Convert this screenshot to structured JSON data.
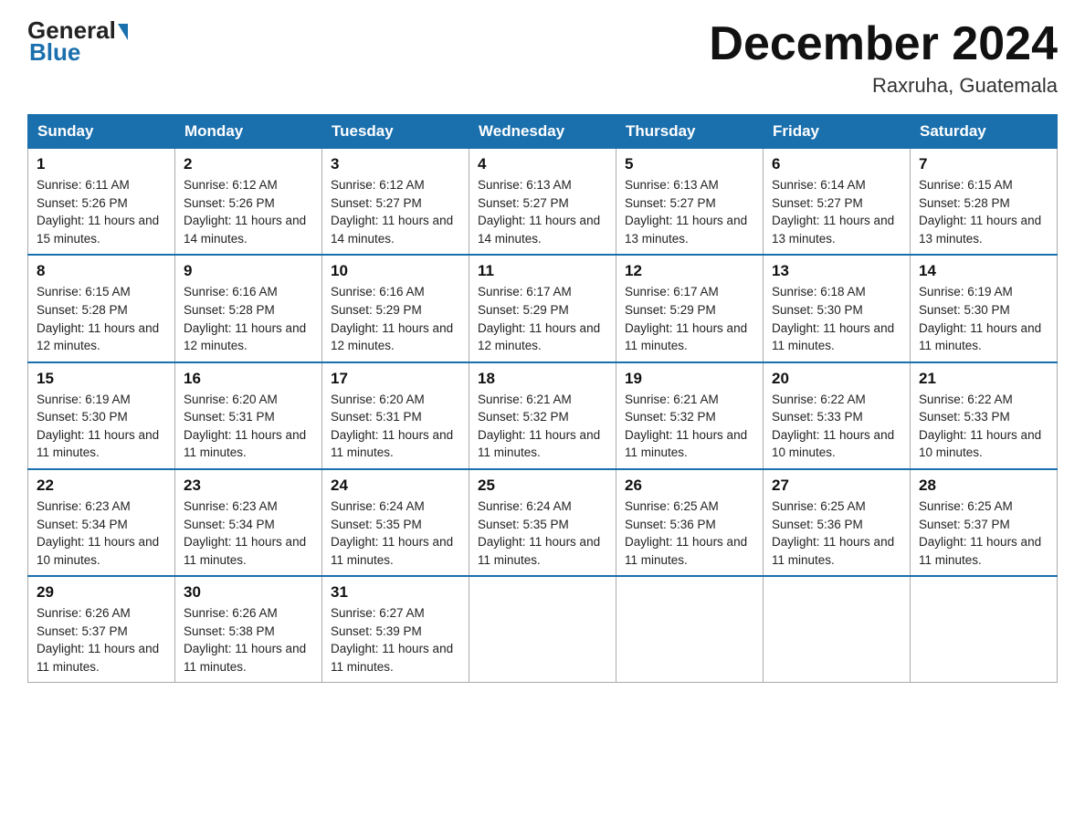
{
  "header": {
    "logo_general": "General",
    "logo_blue": "Blue",
    "month_title": "December 2024",
    "location": "Raxruha, Guatemala"
  },
  "days_of_week": [
    "Sunday",
    "Monday",
    "Tuesday",
    "Wednesday",
    "Thursday",
    "Friday",
    "Saturday"
  ],
  "weeks": [
    [
      {
        "num": "1",
        "sunrise": "6:11 AM",
        "sunset": "5:26 PM",
        "daylight": "11 hours and 15 minutes."
      },
      {
        "num": "2",
        "sunrise": "6:12 AM",
        "sunset": "5:26 PM",
        "daylight": "11 hours and 14 minutes."
      },
      {
        "num": "3",
        "sunrise": "6:12 AM",
        "sunset": "5:27 PM",
        "daylight": "11 hours and 14 minutes."
      },
      {
        "num": "4",
        "sunrise": "6:13 AM",
        "sunset": "5:27 PM",
        "daylight": "11 hours and 14 minutes."
      },
      {
        "num": "5",
        "sunrise": "6:13 AM",
        "sunset": "5:27 PM",
        "daylight": "11 hours and 13 minutes."
      },
      {
        "num": "6",
        "sunrise": "6:14 AM",
        "sunset": "5:27 PM",
        "daylight": "11 hours and 13 minutes."
      },
      {
        "num": "7",
        "sunrise": "6:15 AM",
        "sunset": "5:28 PM",
        "daylight": "11 hours and 13 minutes."
      }
    ],
    [
      {
        "num": "8",
        "sunrise": "6:15 AM",
        "sunset": "5:28 PM",
        "daylight": "11 hours and 12 minutes."
      },
      {
        "num": "9",
        "sunrise": "6:16 AM",
        "sunset": "5:28 PM",
        "daylight": "11 hours and 12 minutes."
      },
      {
        "num": "10",
        "sunrise": "6:16 AM",
        "sunset": "5:29 PM",
        "daylight": "11 hours and 12 minutes."
      },
      {
        "num": "11",
        "sunrise": "6:17 AM",
        "sunset": "5:29 PM",
        "daylight": "11 hours and 12 minutes."
      },
      {
        "num": "12",
        "sunrise": "6:17 AM",
        "sunset": "5:29 PM",
        "daylight": "11 hours and 11 minutes."
      },
      {
        "num": "13",
        "sunrise": "6:18 AM",
        "sunset": "5:30 PM",
        "daylight": "11 hours and 11 minutes."
      },
      {
        "num": "14",
        "sunrise": "6:19 AM",
        "sunset": "5:30 PM",
        "daylight": "11 hours and 11 minutes."
      }
    ],
    [
      {
        "num": "15",
        "sunrise": "6:19 AM",
        "sunset": "5:30 PM",
        "daylight": "11 hours and 11 minutes."
      },
      {
        "num": "16",
        "sunrise": "6:20 AM",
        "sunset": "5:31 PM",
        "daylight": "11 hours and 11 minutes."
      },
      {
        "num": "17",
        "sunrise": "6:20 AM",
        "sunset": "5:31 PM",
        "daylight": "11 hours and 11 minutes."
      },
      {
        "num": "18",
        "sunrise": "6:21 AM",
        "sunset": "5:32 PM",
        "daylight": "11 hours and 11 minutes."
      },
      {
        "num": "19",
        "sunrise": "6:21 AM",
        "sunset": "5:32 PM",
        "daylight": "11 hours and 11 minutes."
      },
      {
        "num": "20",
        "sunrise": "6:22 AM",
        "sunset": "5:33 PM",
        "daylight": "11 hours and 10 minutes."
      },
      {
        "num": "21",
        "sunrise": "6:22 AM",
        "sunset": "5:33 PM",
        "daylight": "11 hours and 10 minutes."
      }
    ],
    [
      {
        "num": "22",
        "sunrise": "6:23 AM",
        "sunset": "5:34 PM",
        "daylight": "11 hours and 10 minutes."
      },
      {
        "num": "23",
        "sunrise": "6:23 AM",
        "sunset": "5:34 PM",
        "daylight": "11 hours and 11 minutes."
      },
      {
        "num": "24",
        "sunrise": "6:24 AM",
        "sunset": "5:35 PM",
        "daylight": "11 hours and 11 minutes."
      },
      {
        "num": "25",
        "sunrise": "6:24 AM",
        "sunset": "5:35 PM",
        "daylight": "11 hours and 11 minutes."
      },
      {
        "num": "26",
        "sunrise": "6:25 AM",
        "sunset": "5:36 PM",
        "daylight": "11 hours and 11 minutes."
      },
      {
        "num": "27",
        "sunrise": "6:25 AM",
        "sunset": "5:36 PM",
        "daylight": "11 hours and 11 minutes."
      },
      {
        "num": "28",
        "sunrise": "6:25 AM",
        "sunset": "5:37 PM",
        "daylight": "11 hours and 11 minutes."
      }
    ],
    [
      {
        "num": "29",
        "sunrise": "6:26 AM",
        "sunset": "5:37 PM",
        "daylight": "11 hours and 11 minutes."
      },
      {
        "num": "30",
        "sunrise": "6:26 AM",
        "sunset": "5:38 PM",
        "daylight": "11 hours and 11 minutes."
      },
      {
        "num": "31",
        "sunrise": "6:27 AM",
        "sunset": "5:39 PM",
        "daylight": "11 hours and 11 minutes."
      },
      null,
      null,
      null,
      null
    ]
  ]
}
